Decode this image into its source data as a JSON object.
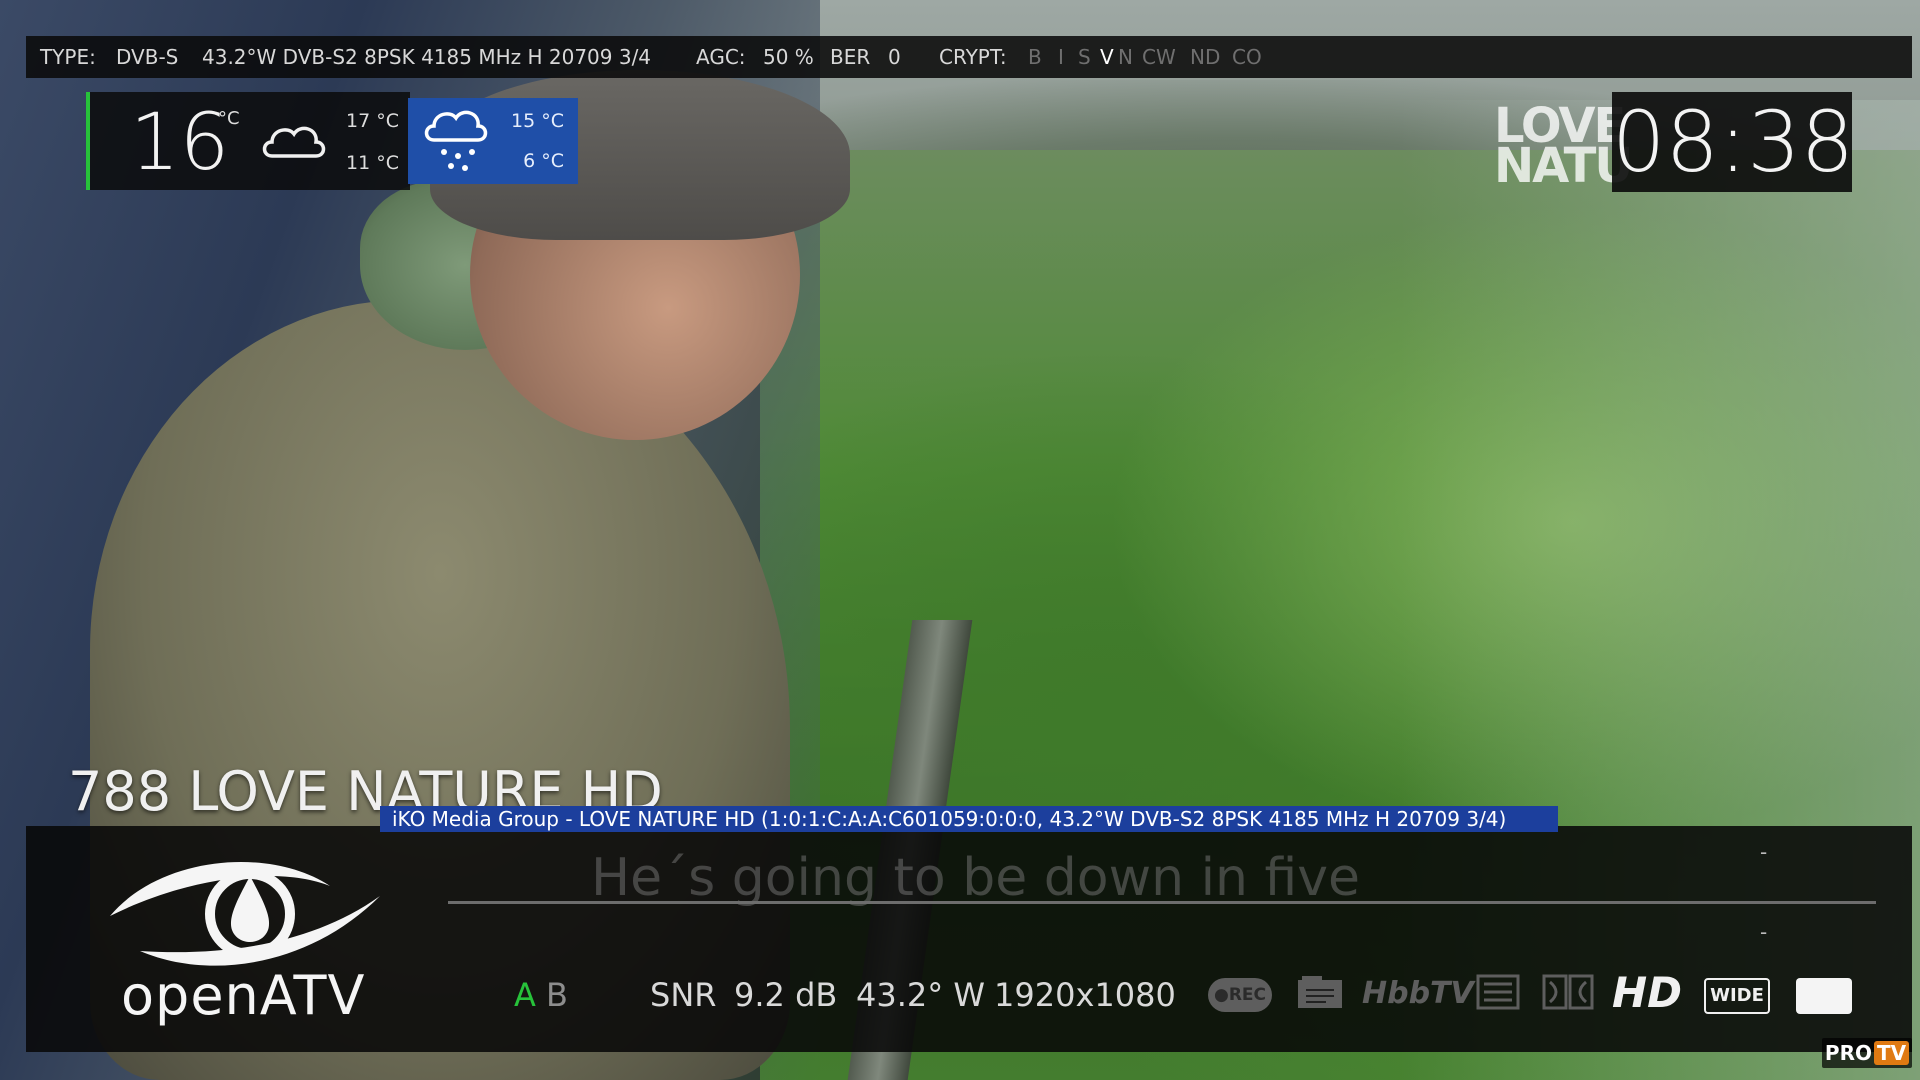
{
  "top_bar": {
    "type_label": "TYPE:",
    "type_value": "DVB-S",
    "transponder": "43.2°W DVB-S2 8PSK 4185 MHz H 20709 3/4",
    "agc_label": "AGC:",
    "agc_value": "50 %",
    "ber_label": "BER",
    "ber_value": "0",
    "crypt_label": "CRYPT:",
    "crypt_flags": [
      {
        "label": "B",
        "active": false
      },
      {
        "label": "I",
        "active": false
      },
      {
        "label": "S",
        "active": false
      },
      {
        "label": "V",
        "active": true
      },
      {
        "label": "N",
        "active": false
      },
      {
        "label": "CW",
        "active": false
      },
      {
        "label": "ND",
        "active": false
      },
      {
        "label": "CO",
        "active": false
      }
    ]
  },
  "weather": {
    "current_temp": "16",
    "current_unit": "°C",
    "current_icon": "cloud-icon",
    "today_high": "17 °C",
    "today_low": "11 °C",
    "tomorrow_icon": "rain-cloud-icon",
    "tomorrow_high": "15 °C",
    "tomorrow_low": "6 °C",
    "accent_color": "#27c23a",
    "tomorrow_bg": "#1f4fa8"
  },
  "channel_logo": "LOVE\nNATU",
  "clock": "08:38",
  "channel": {
    "number_and_name": "788 LOVE NATURE HD",
    "service_info": "iKO Media Group - LOVE NATURE HD (1:0:1:C:A:A:C601059:0:0:0, 43.2°W DVB-S2 8PSK 4185 MHz H 20709 3/4)"
  },
  "infobar": {
    "brand": "openATV",
    "current_program": "He´s going to be down in five",
    "dash_top": "-",
    "dash_bottom": "-",
    "tuner_active": "A",
    "tuner_inactive": "B",
    "snr_label": "SNR",
    "snr_value": "9.2 dB",
    "orbital": "43.2° W",
    "resolution": "1920x1080",
    "rec_label": "●REC",
    "hbbtv_label": "HbbTV",
    "hd_label": "HD",
    "wide_label": "WIDE"
  },
  "watermark": {
    "pro": "PRO",
    "tv": "TV"
  }
}
